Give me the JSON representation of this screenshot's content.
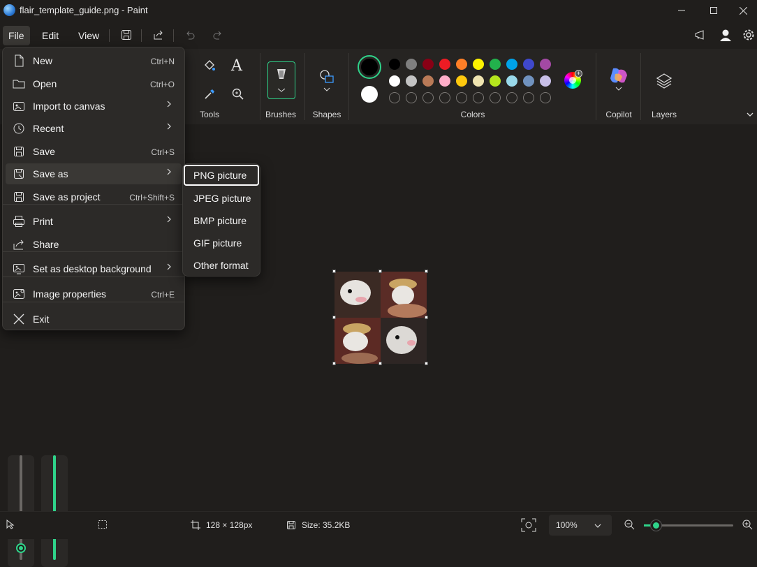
{
  "window": {
    "title": "flair_template_guide.png - Paint"
  },
  "menubar": {
    "file": "File",
    "edit": "Edit",
    "view": "View"
  },
  "ribbon": {
    "tools_label": "Tools",
    "brushes_label": "Brushes",
    "shapes_label": "Shapes",
    "colors_label": "Colors",
    "copilot_label": "Copilot",
    "layers_label": "Layers",
    "text_glyph": "A",
    "primary_color": "#000000",
    "secondary_color": "#ffffff",
    "palette_row1": [
      "#000000",
      "#7f7f7f",
      "#880015",
      "#ed1c24",
      "#ff7f27",
      "#fff200",
      "#22b14c",
      "#00a2e8",
      "#3f48cc",
      "#a349a4"
    ],
    "palette_row2": [
      "#ffffff",
      "#c3c3c3",
      "#b97a57",
      "#ffaec9",
      "#ffc90e",
      "#efe4b0",
      "#b5e61d",
      "#99d9ea",
      "#7092be",
      "#c8bfe7"
    ]
  },
  "file_menu": {
    "items": [
      {
        "label": "New",
        "shortcut": "Ctrl+N",
        "icon": "new-file-icon"
      },
      {
        "label": "Open",
        "shortcut": "Ctrl+O",
        "icon": "folder-icon"
      },
      {
        "label": "Import to canvas",
        "shortcut": "",
        "icon": "import-icon"
      },
      {
        "label": "Recent",
        "shortcut": "",
        "icon": "clock-icon"
      },
      {
        "label": "Save",
        "shortcut": "Ctrl+S",
        "icon": "save-icon"
      },
      {
        "label": "Save as",
        "shortcut": "",
        "icon": "save-as-icon"
      },
      {
        "label": "Save as project",
        "shortcut": "Ctrl+Shift+S",
        "icon": "save-project-icon"
      },
      {
        "label": "Print",
        "shortcut": "",
        "icon": "printer-icon"
      },
      {
        "label": "Share",
        "shortcut": "",
        "icon": "share-icon"
      },
      {
        "label": "Set as desktop background",
        "shortcut": "",
        "icon": "desktop-icon"
      },
      {
        "label": "Image properties",
        "shortcut": "Ctrl+E",
        "icon": "image-properties-icon"
      },
      {
        "label": "Exit",
        "shortcut": "",
        "icon": "close-icon"
      }
    ]
  },
  "save_as_menu": {
    "items": [
      "PNG picture",
      "JPEG picture",
      "BMP picture",
      "GIF picture",
      "Other format"
    ]
  },
  "status": {
    "dimensions": "128 × 128px",
    "size": "Size: 35.2KB",
    "zoom": "100%"
  }
}
